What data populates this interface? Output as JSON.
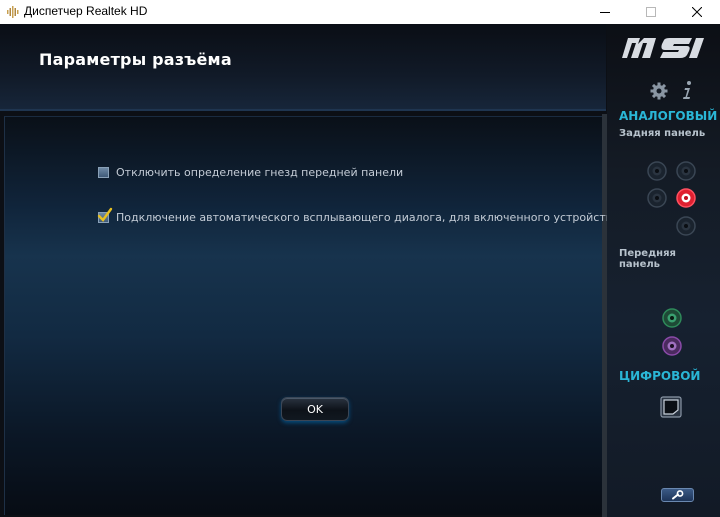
{
  "window": {
    "title": "Диспетчер Realtek HD"
  },
  "page": {
    "title": "Параметры разъёма"
  },
  "options": [
    {
      "label": "Отключить определение гнезд передней панели",
      "checked": false
    },
    {
      "label": "Подключение автоматического всплывающего диалога, для включенного устройства",
      "checked": true
    }
  ],
  "ok_label": "OK",
  "sidebar": {
    "analog_label": "АНАЛОГОВЫЙ",
    "rear_panel_label": "Задняя панель",
    "front_panel_label": "Передняя панель",
    "digital_label": "ЦИФРОВОЙ"
  },
  "colors": {
    "accent": "#2ab6d6",
    "jack_active": "#e02030",
    "jack_green": "#2e8a5a",
    "jack_purple": "#8a4aa8"
  }
}
